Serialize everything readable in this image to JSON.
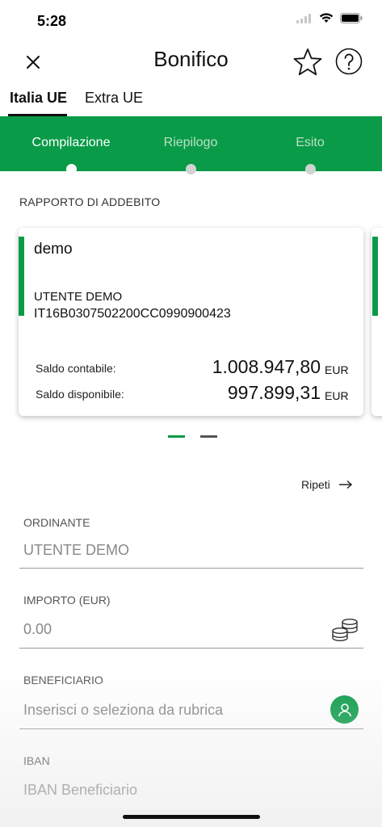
{
  "status_bar": {
    "time": "5:28"
  },
  "header": {
    "title": "Bonifico"
  },
  "tabs": [
    {
      "label": "Italia UE",
      "active": true
    },
    {
      "label": "Extra UE",
      "active": false
    }
  ],
  "stepper": {
    "steps": [
      {
        "label": "Compilazione",
        "active": true
      },
      {
        "label": "Riepilogo",
        "active": false
      },
      {
        "label": "Esito",
        "active": false
      }
    ]
  },
  "debit_section": {
    "label": "RAPPORTO DI ADDEBITO",
    "card": {
      "name": "demo",
      "holder": "UTENTE DEMO",
      "iban": "IT16B0307502200CC0990900423",
      "accounting_balance_label": "Saldo contabile:",
      "accounting_balance_value": "1.008.947,80",
      "available_balance_label": "Saldo disponibile:",
      "available_balance_value": "997.899,31",
      "currency": "EUR"
    }
  },
  "repeat_label": "Ripeti",
  "form": {
    "ordinante": {
      "label": "ORDINANTE",
      "value": "UTENTE DEMO"
    },
    "importo": {
      "label": "IMPORTO (EUR)",
      "placeholder": "0.00"
    },
    "beneficiario": {
      "label": "BENEFICIARIO",
      "placeholder": "Inserisci o seleziona da rubrica"
    },
    "iban": {
      "label": "IBAN",
      "placeholder": "IBAN Beneficiario"
    }
  },
  "colors": {
    "brand_green": "#0a9b48"
  },
  "icons": [
    "close-icon",
    "star-icon",
    "help-icon",
    "arrow-right-icon",
    "coins-icon",
    "contact-icon",
    "signal-icon",
    "wifi-icon",
    "battery-icon"
  ]
}
